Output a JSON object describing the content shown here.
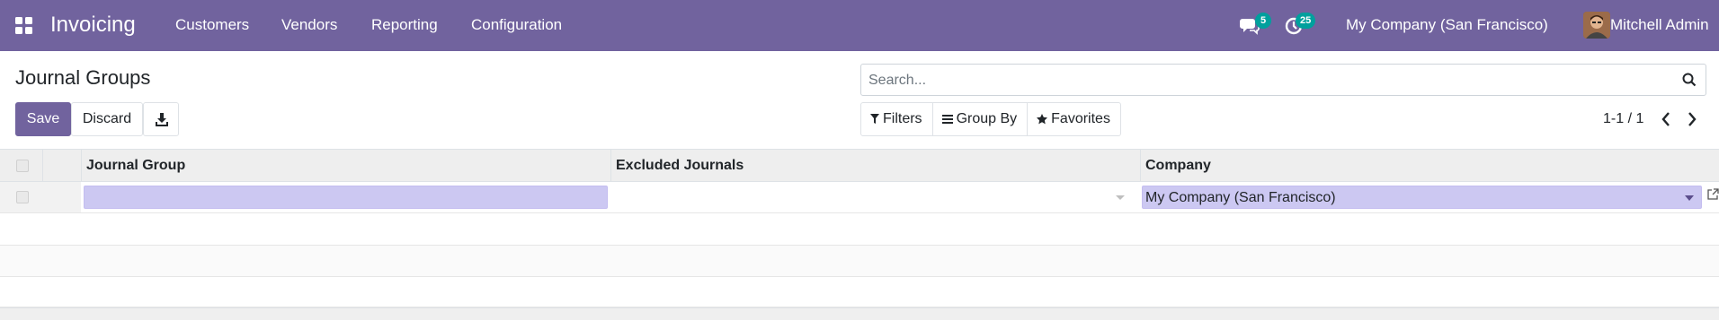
{
  "navbar": {
    "apps_icon": "grid-icon",
    "brand": "Invoicing",
    "menu": [
      "Customers",
      "Vendors",
      "Reporting",
      "Configuration"
    ],
    "messages_icon": "chat-icon",
    "messages_count": "5",
    "activities_icon": "clock-icon",
    "activities_count": "25",
    "company": "My Company (San Francisco)",
    "user": "Mitchell Admin",
    "color": "#71639e"
  },
  "control_panel": {
    "title": "Journal Groups",
    "save_label": "Save",
    "discard_label": "Discard",
    "download_icon": "download-icon",
    "search_placeholder": "Search...",
    "filters_label": "Filters",
    "group_by_label": "Group By",
    "favorites_label": "Favorites",
    "pager": "1-1 / 1"
  },
  "table": {
    "columns": [
      "Journal Group",
      "Excluded Journals",
      "Company"
    ],
    "edit_row": {
      "journal_group": "",
      "excluded_journals": "",
      "company": "My Company (San Francisco)"
    }
  }
}
